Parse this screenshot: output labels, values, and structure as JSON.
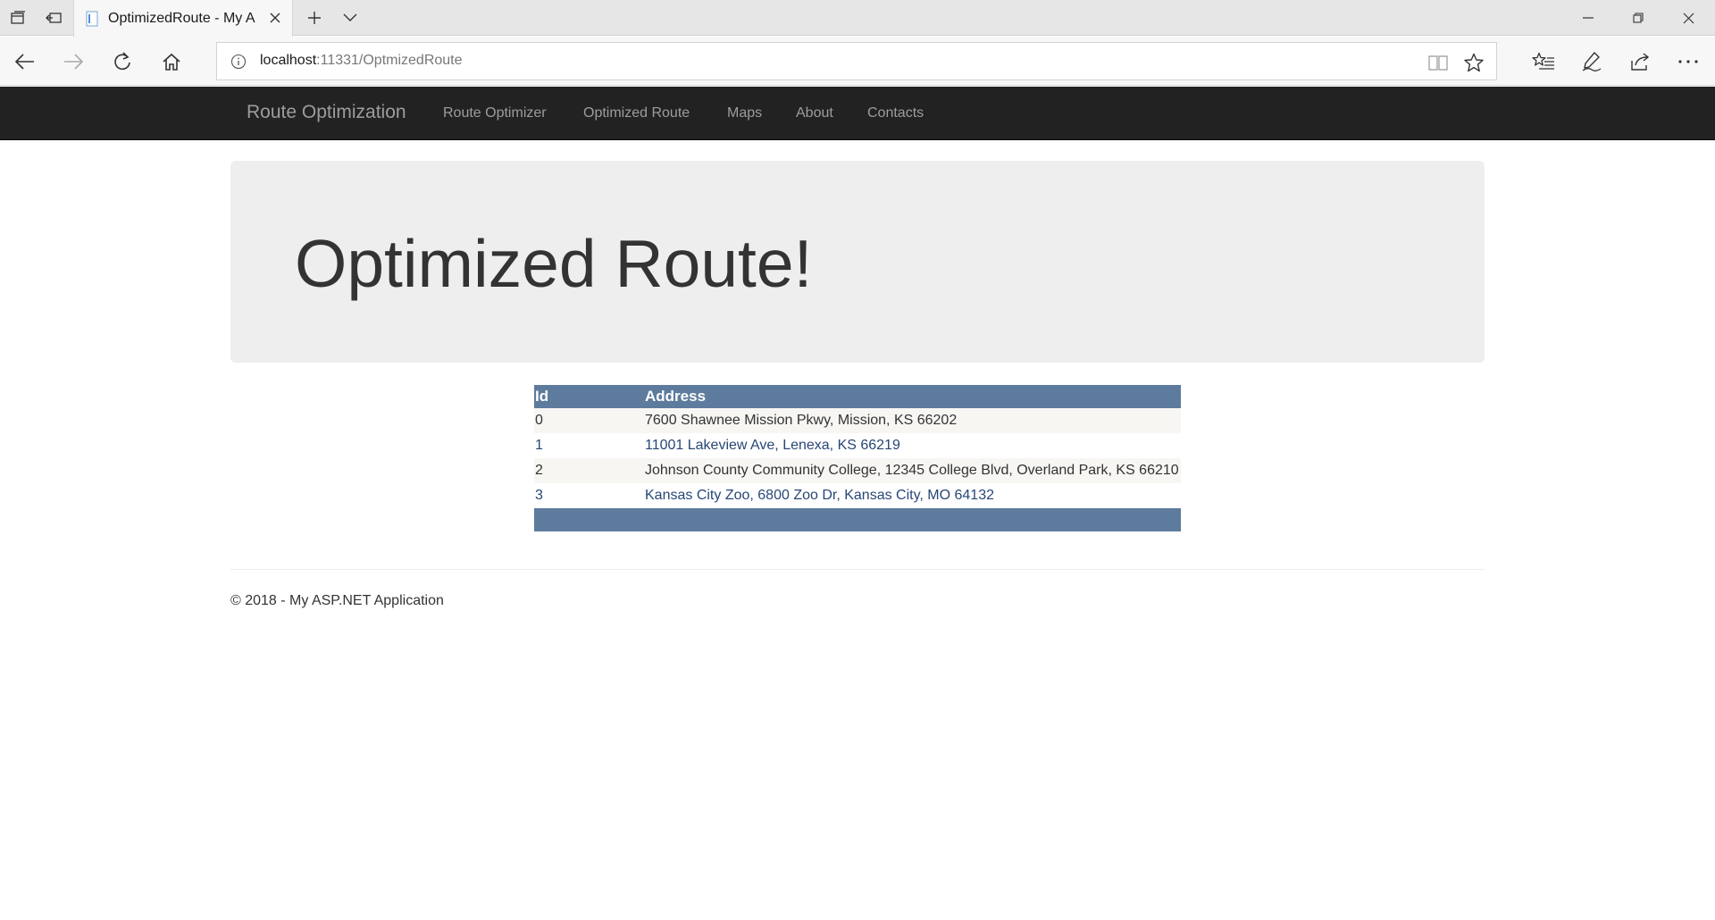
{
  "browser": {
    "tab_title": "OptimizedRoute - My A",
    "address_host": "localhost",
    "address_path": ":11331/OptmizedRoute"
  },
  "site_nav": {
    "brand": "Route Optimization",
    "links": [
      "Route Optimizer",
      "Optimized Route",
      "Maps",
      "About",
      "Contacts"
    ]
  },
  "jumbotron": {
    "heading": "Optimized Route!"
  },
  "table": {
    "headers": [
      "Id",
      "Address"
    ],
    "rows": [
      {
        "id": "0",
        "address": "7600 Shawnee Mission Pkwy, Mission, KS 66202"
      },
      {
        "id": "1",
        "address": "11001 Lakeview Ave, Lenexa, KS 66219"
      },
      {
        "id": "2",
        "address": "Johnson County Community College, 12345 College Blvd, Overland Park, KS 66210"
      },
      {
        "id": "3",
        "address": "Kansas City Zoo, 6800 Zoo Dr, Kansas City, MO 64132"
      }
    ]
  },
  "footer": {
    "copyright": "© 2018 - My ASP.NET Application"
  },
  "colors": {
    "navbar_bg": "#222222",
    "table_header": "#5d7b9d",
    "row_alt": "#f7f6f3",
    "link_text": "#284775"
  }
}
